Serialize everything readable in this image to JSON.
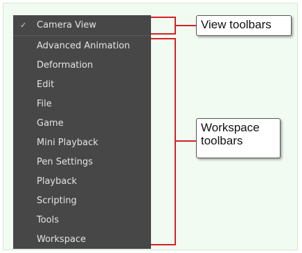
{
  "menu": {
    "checked_mark": "✓",
    "items": [
      {
        "label": "Camera View",
        "checked": true
      },
      {
        "label": "Advanced Animation"
      },
      {
        "label": "Deformation"
      },
      {
        "label": "Edit"
      },
      {
        "label": "File"
      },
      {
        "label": "Game"
      },
      {
        "label": "Mini Playback"
      },
      {
        "label": "Pen Settings"
      },
      {
        "label": "Playback"
      },
      {
        "label": "Scripting"
      },
      {
        "label": "Tools"
      },
      {
        "label": "Workspace"
      }
    ]
  },
  "callouts": {
    "view_toolbars": "View toolbars",
    "workspace_toolbars": "Workspace\ntoolbars"
  },
  "colors": {
    "menu_background": "#474747",
    "annotation_red": "#d42020",
    "frame_background": "#f2fbf2"
  }
}
